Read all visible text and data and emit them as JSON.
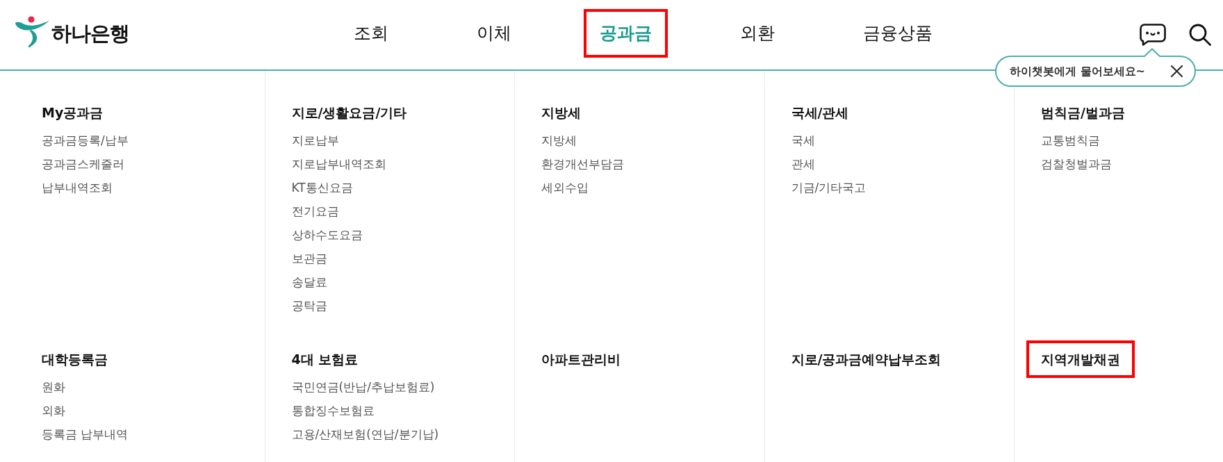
{
  "logo": {
    "text": "하나은행"
  },
  "nav": [
    {
      "label": "조회",
      "selected": false,
      "highlighted": false
    },
    {
      "label": "이체",
      "selected": false,
      "highlighted": false
    },
    {
      "label": "공과금",
      "selected": true,
      "highlighted": true
    },
    {
      "label": "외환",
      "selected": false,
      "highlighted": false
    },
    {
      "label": "금융상품",
      "selected": false,
      "highlighted": false
    }
  ],
  "chatbot_tooltip": {
    "text": "하이챗봇에게 물어보세요~"
  },
  "menu_groups": [
    {
      "title": "My공과금",
      "highlighted": false,
      "items": [
        "공과금등록/납부",
        "공과금스케줄러",
        "납부내역조회"
      ]
    },
    {
      "title": "지로/생활요금/기타",
      "highlighted": false,
      "items": [
        "지로납부",
        "지로납부내역조회",
        "KT통신요금",
        "전기요금",
        "상하수도요금",
        "보관금",
        "송달료",
        "공탁금"
      ]
    },
    {
      "title": "지방세",
      "highlighted": false,
      "items": [
        "지방세",
        "환경개선부담금",
        "세외수입"
      ]
    },
    {
      "title": "국세/관세",
      "highlighted": false,
      "items": [
        "국세",
        "관세",
        "기금/기타국고"
      ]
    },
    {
      "title": "범칙금/벌과금",
      "highlighted": false,
      "items": [
        "교통범칙금",
        "검찰청벌과금"
      ]
    },
    {
      "title": "대학등록금",
      "highlighted": false,
      "items": [
        "원화",
        "외화",
        "등록금 납부내역"
      ]
    },
    {
      "title": "4대 보험료",
      "highlighted": false,
      "items": [
        "국민연금(반납/추납보험료)",
        "통합징수보험료",
        "고용/산재보험(연납/분기납)"
      ]
    },
    {
      "title": "아파트관리비",
      "highlighted": false
    },
    {
      "title": "지로/공과금예약납부조회",
      "highlighted": false
    },
    {
      "title": "지역개발채권",
      "highlighted": true
    }
  ]
}
